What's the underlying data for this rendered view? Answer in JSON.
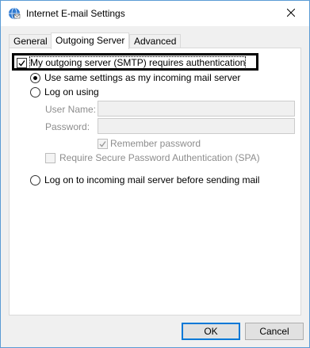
{
  "window": {
    "title": "Internet E-mail Settings",
    "icon": "globe-mail-icon"
  },
  "tabs": [
    {
      "label": "General",
      "active": false
    },
    {
      "label": "Outgoing Server",
      "active": true
    },
    {
      "label": "Advanced",
      "active": false
    }
  ],
  "outgoing": {
    "smtp_auth_label": "My outgoing server (SMTP) requires authentication",
    "smtp_auth_checked": true,
    "use_same_label": "Use same settings as my incoming mail server",
    "use_same_checked": true,
    "log_on_using_label": "Log on using",
    "log_on_using_checked": false,
    "username_label": "User Name:",
    "username_value": "",
    "password_label": "Password:",
    "password_value": "",
    "remember_password_label": "Remember password",
    "remember_password_checked": true,
    "spa_label": "Require Secure Password Authentication (SPA)",
    "spa_checked": false,
    "log_on_incoming_label": "Log on to incoming mail server before sending mail",
    "log_on_incoming_checked": false
  },
  "buttons": {
    "ok": "OK",
    "cancel": "Cancel"
  },
  "colors": {
    "window_border": "#5b9bd5",
    "dialog_bg": "#f0f0f0",
    "disabled_text": "#8d8d8d",
    "default_button_border": "#0078d7"
  }
}
